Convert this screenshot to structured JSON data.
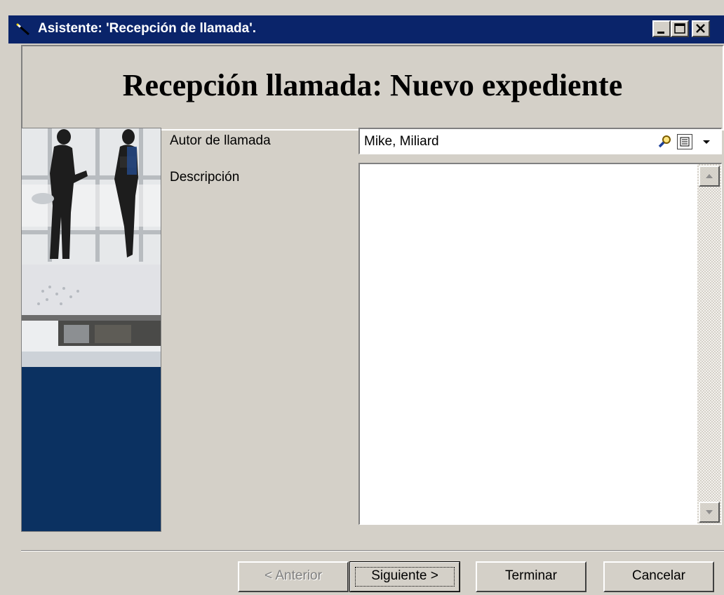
{
  "window": {
    "title": "Asistente: 'Recepción de llamada'.",
    "title_color": "#0a246a"
  },
  "header": {
    "title": "Recepción llamada: Nuevo expediente"
  },
  "form": {
    "author_label": "Autor de llamada",
    "author_value": "Mike, Miliard",
    "description_label": "Descripción",
    "description_value": ""
  },
  "buttons": {
    "previous": "< Anterior",
    "next": "Siguiente >",
    "finish": "Terminar",
    "cancel": "Cancelar"
  },
  "icons": {
    "app": "wand-icon",
    "search": "magnifier-icon",
    "list": "list-icon",
    "dropdown": "chevron-down-icon"
  },
  "colors": {
    "panel_bg": "#d4d0c8",
    "sidebar_navy": "#0b3161"
  }
}
